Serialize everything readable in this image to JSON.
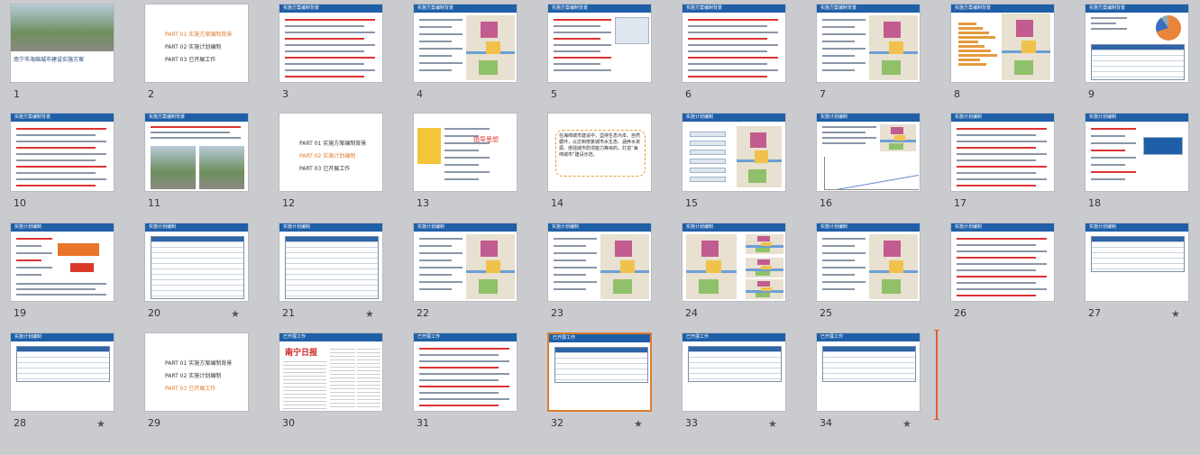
{
  "slides": [
    {
      "num": "1",
      "star": false,
      "title": "南宁市海绵城市建设实施方案",
      "kind": "cover"
    },
    {
      "num": "2",
      "star": false,
      "kind": "toc",
      "parts": [
        {
          "p": "PART 01",
          "t": "实施方案编制背景",
          "hl": true
        },
        {
          "p": "PART 02",
          "t": "实施计划编制",
          "hl": false
        },
        {
          "p": "PART 03",
          "t": "已开展工作",
          "hl": false
        }
      ]
    },
    {
      "num": "3",
      "star": false,
      "kind": "text",
      "hdr": "实施方案编制背景"
    },
    {
      "num": "4",
      "star": false,
      "kind": "textmap",
      "hdr": "实施方案编制背景"
    },
    {
      "num": "5",
      "star": false,
      "kind": "textfig",
      "hdr": "实施方案编制背景"
    },
    {
      "num": "6",
      "star": false,
      "kind": "text",
      "hdr": "实施方案编制背景"
    },
    {
      "num": "7",
      "star": false,
      "kind": "textmap",
      "hdr": "实施方案编制背景"
    },
    {
      "num": "8",
      "star": false,
      "kind": "barmap",
      "hdr": "实施方案编制背景"
    },
    {
      "num": "9",
      "star": false,
      "kind": "pietable",
      "hdr": "实施方案编制背景"
    },
    {
      "num": "10",
      "star": false,
      "kind": "text",
      "hdr": "实施方案编制背景"
    },
    {
      "num": "11",
      "star": false,
      "kind": "photos",
      "hdr": "实施方案编制背景"
    },
    {
      "num": "12",
      "star": false,
      "kind": "toc",
      "parts": [
        {
          "p": "PART 01",
          "t": "实施方案编制背景",
          "hl": false
        },
        {
          "p": "PART 02",
          "t": "实施计划编制",
          "hl": true
        },
        {
          "p": "PART 03",
          "t": "已开展工作",
          "hl": false
        }
      ]
    },
    {
      "num": "13",
      "star": false,
      "kind": "guide",
      "guide": "指导思想"
    },
    {
      "num": "14",
      "star": false,
      "kind": "bubble",
      "bubble": "在海绵城市建设中，坚持生态为本、自然循环，以达到修复城市水生态、涵养水资源、增强城市防涝能力等目的，打造“海绵城市”建设示范。"
    },
    {
      "num": "15",
      "star": false,
      "kind": "labelsmap",
      "hdr": "实施计划编制"
    },
    {
      "num": "16",
      "star": false,
      "kind": "curve",
      "hdr": "实施计划编制"
    },
    {
      "num": "17",
      "star": false,
      "kind": "text",
      "hdr": "实施计划编制"
    },
    {
      "num": "18",
      "star": false,
      "kind": "arrowbox",
      "hdr": "实施计划编制"
    },
    {
      "num": "19",
      "star": false,
      "kind": "arrowbox2",
      "hdr": "实施计划编制"
    },
    {
      "num": "20",
      "star": true,
      "kind": "table",
      "hdr": "实施计划编制"
    },
    {
      "num": "21",
      "star": true,
      "kind": "table",
      "hdr": "实施计划编制"
    },
    {
      "num": "22",
      "star": false,
      "kind": "textmap",
      "hdr": "实施计划编制"
    },
    {
      "num": "23",
      "star": false,
      "kind": "textmap",
      "hdr": "实施计划编制"
    },
    {
      "num": "24",
      "star": false,
      "kind": "mapzoom",
      "hdr": "实施计划编制"
    },
    {
      "num": "25",
      "star": false,
      "kind": "textmap",
      "hdr": "实施计划编制"
    },
    {
      "num": "26",
      "star": false,
      "kind": "text",
      "hdr": "实施计划编制"
    },
    {
      "num": "27",
      "star": true,
      "kind": "table",
      "hdr": "实施计划编制"
    },
    {
      "num": "28",
      "star": true,
      "kind": "table",
      "hdr": "实施计划编制"
    },
    {
      "num": "29",
      "star": false,
      "kind": "toc",
      "parts": [
        {
          "p": "PART 01",
          "t": "实施方案编制背景",
          "hl": false
        },
        {
          "p": "PART 02",
          "t": "实施计划编制",
          "hl": false
        },
        {
          "p": "PART 03",
          "t": "已开展工作",
          "hl": true
        }
      ]
    },
    {
      "num": "30",
      "star": false,
      "kind": "news",
      "hdr": "已开展工作",
      "paper": "南宁日报"
    },
    {
      "num": "31",
      "star": false,
      "kind": "text",
      "hdr": "已开展工作"
    },
    {
      "num": "32",
      "star": true,
      "kind": "table",
      "hdr": "已开展工作",
      "selected": true
    },
    {
      "num": "33",
      "star": true,
      "kind": "table",
      "hdr": "已开展工作"
    },
    {
      "num": "34",
      "star": true,
      "kind": "table",
      "hdr": "已开展工作"
    }
  ],
  "colors": {
    "background": "#c9cbcf",
    "header": "#1f5fa8",
    "highlight": "#e07c2c"
  },
  "icons": {
    "star": "animation-star-icon"
  }
}
